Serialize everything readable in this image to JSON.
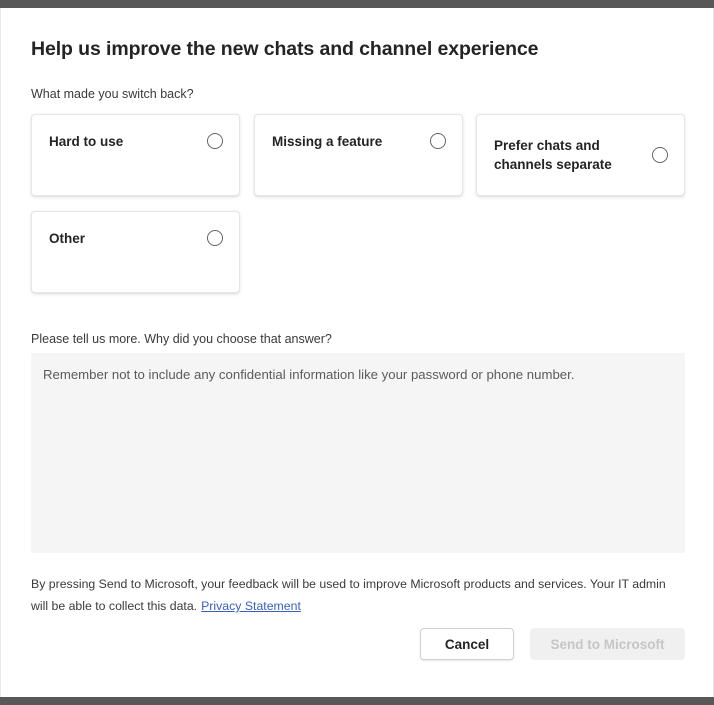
{
  "dialog": {
    "title": "Help us improve the new chats and channel experience",
    "question_label": "What made you switch back?",
    "more_label": "Please tell us more. Why did you choose that answer?"
  },
  "options": [
    {
      "label": "Hard to use",
      "selected": false,
      "radio_icon": "radio-unchecked-icon"
    },
    {
      "label": "Missing a feature",
      "selected": false,
      "radio_icon": "radio-unchecked-icon"
    },
    {
      "label": "Prefer chats and channels separate",
      "selected": false,
      "radio_icon": "radio-unchecked-icon"
    },
    {
      "label": "Other",
      "selected": false,
      "radio_icon": "radio-unchecked-icon"
    }
  ],
  "feedback": {
    "value": "",
    "placeholder": "Remember not to include any confidential information like your password or phone number."
  },
  "disclaimer": {
    "text": "By pressing Send to Microsoft, your feedback will be used to improve Microsoft products and services. Your IT admin will be able to collect this data.",
    "link_label": "Privacy Statement"
  },
  "footer": {
    "cancel_label": "Cancel",
    "send_label": "Send to Microsoft",
    "send_enabled": false
  },
  "colors": {
    "accent_link": "#3b5fbd",
    "text_primary": "#242424",
    "text_secondary": "#3b3a39",
    "field_background": "#f5f5f5",
    "disabled_background": "#f0f0f0",
    "disabled_text": "#c6c6c6",
    "chrome_bar": "#585858"
  }
}
